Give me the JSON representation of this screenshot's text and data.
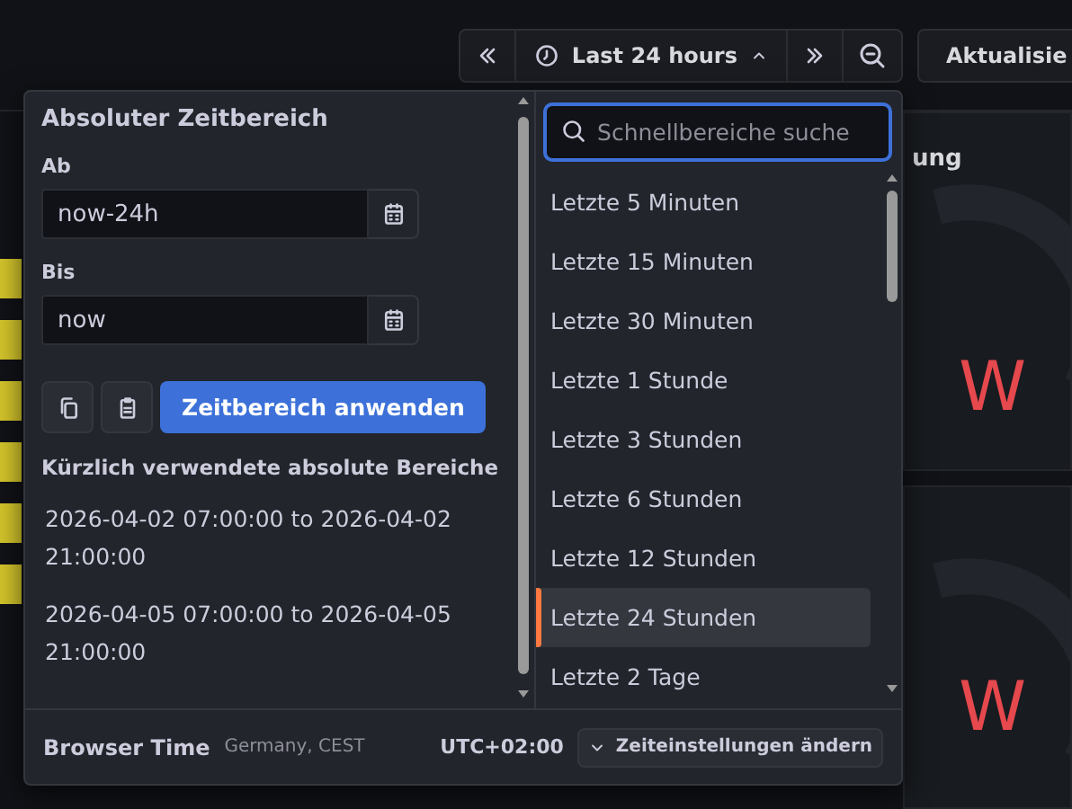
{
  "toolbar": {
    "time_range": "Last 24 hours",
    "refresh_label": "Aktualisie"
  },
  "background_panels": [
    {
      "title": "ung",
      "value": "W"
    },
    {
      "value": "W"
    }
  ],
  "time_picker": {
    "heading": "Absoluter Zeitbereich",
    "from": {
      "label": "Ab",
      "value": "now-24h"
    },
    "to": {
      "label": "Bis",
      "value": "now"
    },
    "apply_button": "Zeitbereich anwenden",
    "recent_heading": "Kürzlich verwendete absolute Bereiche",
    "recent_ranges": [
      "2026-04-02 07:00:00 to 2026-04-02 21:00:00",
      "2026-04-05 07:00:00 to 2026-04-05 21:00:00"
    ],
    "search": {
      "placeholder": "Schnellbereiche suche"
    },
    "quick_ranges": [
      {
        "label": "Letzte 5 Minuten",
        "selected": false
      },
      {
        "label": "Letzte 15 Minuten",
        "selected": false
      },
      {
        "label": "Letzte 30 Minuten",
        "selected": false
      },
      {
        "label": "Letzte 1 Stunde",
        "selected": false
      },
      {
        "label": "Letzte 3 Stunden",
        "selected": false
      },
      {
        "label": "Letzte 6 Stunden",
        "selected": false
      },
      {
        "label": "Letzte 12 Stunden",
        "selected": false
      },
      {
        "label": "Letzte 24 Stunden",
        "selected": true
      },
      {
        "label": "Letzte 2 Tage",
        "selected": false
      }
    ],
    "footer": {
      "title": "Browser Time",
      "zone": "Germany, CEST",
      "offset": "UTC+02:00",
      "settings_button": "Zeiteinstellungen ändern"
    }
  }
}
